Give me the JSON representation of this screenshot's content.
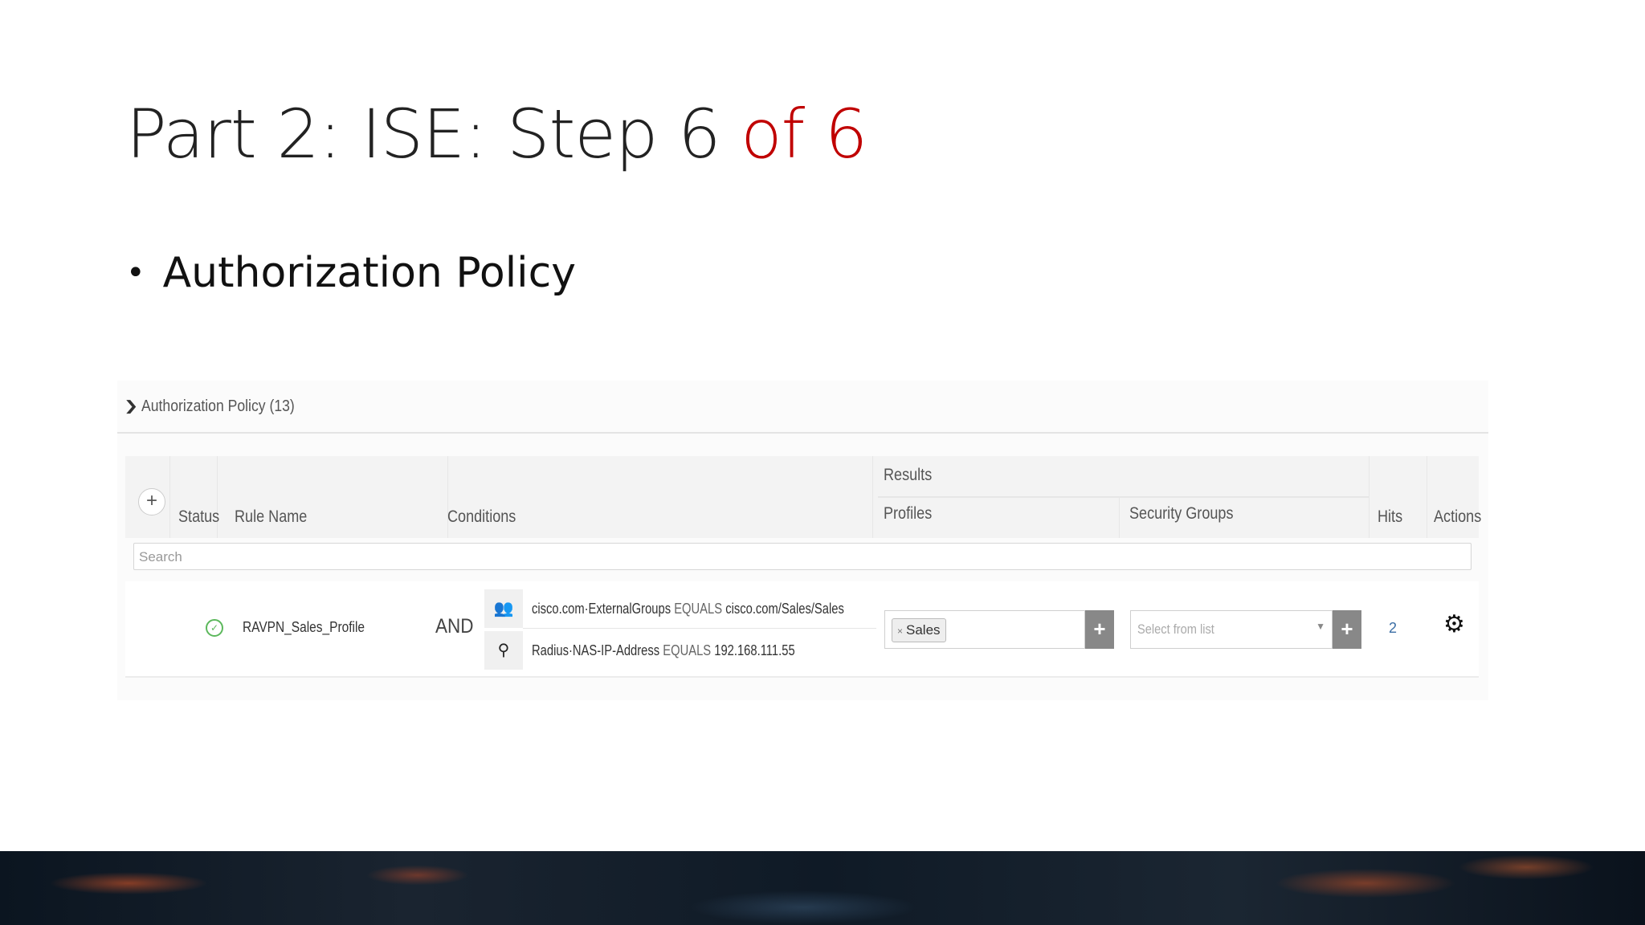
{
  "slide": {
    "title_main": "Part 2: ISE: Step 6 ",
    "title_accent": "of 6",
    "bullet": "Authorization Policy"
  },
  "colors": {
    "accent": "#c00000",
    "status_ok": "#5cb85c",
    "hits_link": "#3b6ea5"
  },
  "policy": {
    "section_title": "Authorization Policy (13)",
    "columns": {
      "status": "Status",
      "rule_name": "Rule Name",
      "conditions": "Conditions",
      "results": "Results",
      "profiles": "Profiles",
      "security_groups": "Security Groups",
      "hits": "Hits",
      "actions": "Actions"
    },
    "search_placeholder": "Search",
    "rule": {
      "name": "RAVPN_Sales_Profile",
      "operator": "AND",
      "conditions": [
        {
          "icon": "user-group-icon",
          "attribute": "cisco.com·ExternalGroups",
          "op": "EQUALS",
          "value": "cisco.com/Sales/Sales"
        },
        {
          "icon": "location-pin-icon",
          "attribute": "Radius·NAS-IP-Address",
          "op": "EQUALS",
          "value": "192.168.111.55"
        }
      ],
      "profile_tag": "Sales",
      "security_group_placeholder": "Select from list",
      "hits": "2"
    }
  }
}
